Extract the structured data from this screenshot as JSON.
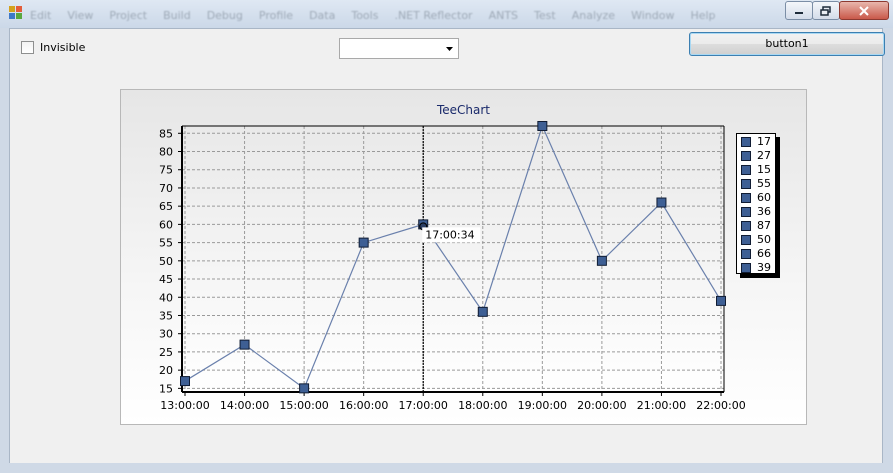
{
  "window": {
    "menu_ghost": [
      "Edit",
      "View",
      "Project",
      "Build",
      "Debug",
      "Profile",
      "Data",
      "Tools",
      ".NET Reflector",
      "ANTS",
      "Test",
      "Analyze",
      "Window",
      "Help"
    ]
  },
  "controls": {
    "checkbox_label": "Invisible",
    "checkbox_checked": false,
    "select_value": "",
    "button_label": "button1"
  },
  "chart_data": {
    "type": "line",
    "title": "TeeChart",
    "x": [
      "13:00:00",
      "14:00:00",
      "15:00:00",
      "16:00:00",
      "17:00:00",
      "18:00:00",
      "19:00:00",
      "20:00:00",
      "21:00:00",
      "22:00:00"
    ],
    "series": [
      {
        "values": [
          17,
          27,
          15,
          55,
          60,
          36,
          87,
          50,
          66,
          39
        ],
        "color": "#3e5f94"
      }
    ],
    "y_ticks": [
      15,
      20,
      25,
      30,
      35,
      40,
      45,
      50,
      55,
      60,
      65,
      70,
      75,
      80,
      85
    ],
    "ylim": [
      14,
      87
    ],
    "grid": true,
    "legend": {
      "placement": "right",
      "entries": [
        "17",
        "27",
        "15",
        "55",
        "60",
        "36",
        "87",
        "50",
        "66",
        "39"
      ]
    },
    "cursor": {
      "x_value": "17:00:00",
      "label": "17:00:34"
    }
  }
}
